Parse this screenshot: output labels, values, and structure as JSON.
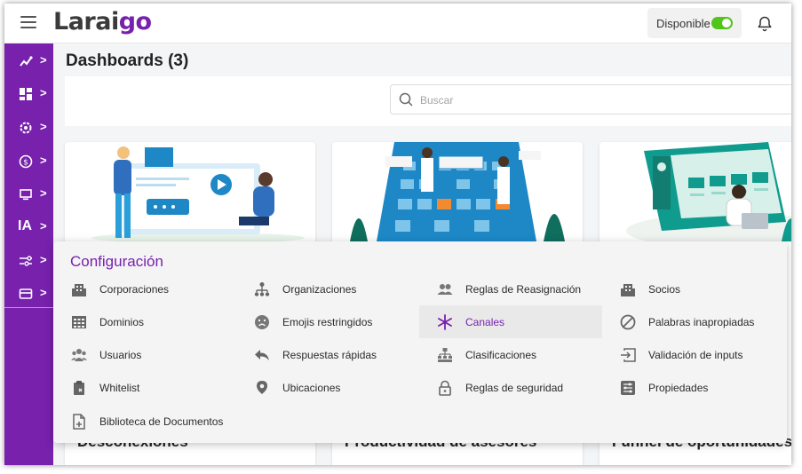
{
  "header": {
    "logo_text": "Laraigo",
    "status_label": "Disponible",
    "status_on": true
  },
  "sidebar": {
    "items": [
      {
        "icon": "analytics-icon"
      },
      {
        "icon": "dashboard-grid-icon"
      },
      {
        "icon": "settings-gear-icon"
      },
      {
        "icon": "billing-icon"
      },
      {
        "icon": "monitor-icon"
      },
      {
        "icon": "ia-icon",
        "label": "IA"
      },
      {
        "icon": "configuration-sliders-icon"
      },
      {
        "icon": "payment-card-icon"
      }
    ],
    "color": "#7721ad"
  },
  "page": {
    "title": "Dashboards (3)",
    "search_placeholder": "Buscar"
  },
  "cards": [
    {
      "title": "Desconexiones"
    },
    {
      "title": "Productividad de asesores"
    },
    {
      "title": "Funnel de oportunidades"
    }
  ],
  "menu": {
    "title": "Configuración",
    "items": [
      {
        "label": "Corporaciones",
        "icon": "building-icon"
      },
      {
        "label": "Organizaciones",
        "icon": "org-chart-icon"
      },
      {
        "label": "Reglas de Reasignación",
        "icon": "people-icon"
      },
      {
        "label": "Socios",
        "icon": "building-icon"
      },
      {
        "label": "Dominios",
        "icon": "grid-table-icon"
      },
      {
        "label": "Emojis restringidos",
        "icon": "sad-face-icon"
      },
      {
        "label": "Canales",
        "icon": "asterisk-icon",
        "active": true
      },
      {
        "label": "Palabras inapropiadas",
        "icon": "block-icon"
      },
      {
        "label": "Usuarios",
        "icon": "users-group-icon"
      },
      {
        "label": "Respuestas rápidas",
        "icon": "reply-icon"
      },
      {
        "label": "Clasificaciones",
        "icon": "hierarchy-icon"
      },
      {
        "label": "Validación de inputs",
        "icon": "input-icon"
      },
      {
        "label": "Whitelist",
        "icon": "clipboard-icon"
      },
      {
        "label": "Ubicaciones",
        "icon": "location-pin-icon"
      },
      {
        "label": "Reglas de seguridad",
        "icon": "lock-icon"
      },
      {
        "label": "Propiedades",
        "icon": "sliders-icon"
      },
      {
        "label": "Biblioteca de Documentos",
        "icon": "document-add-icon"
      }
    ]
  },
  "colors": {
    "accent": "#7721ad",
    "toggle_on": "#52c41a",
    "illustration_blue": "#1e88c7",
    "illustration_teal": "#0f9b8e"
  }
}
